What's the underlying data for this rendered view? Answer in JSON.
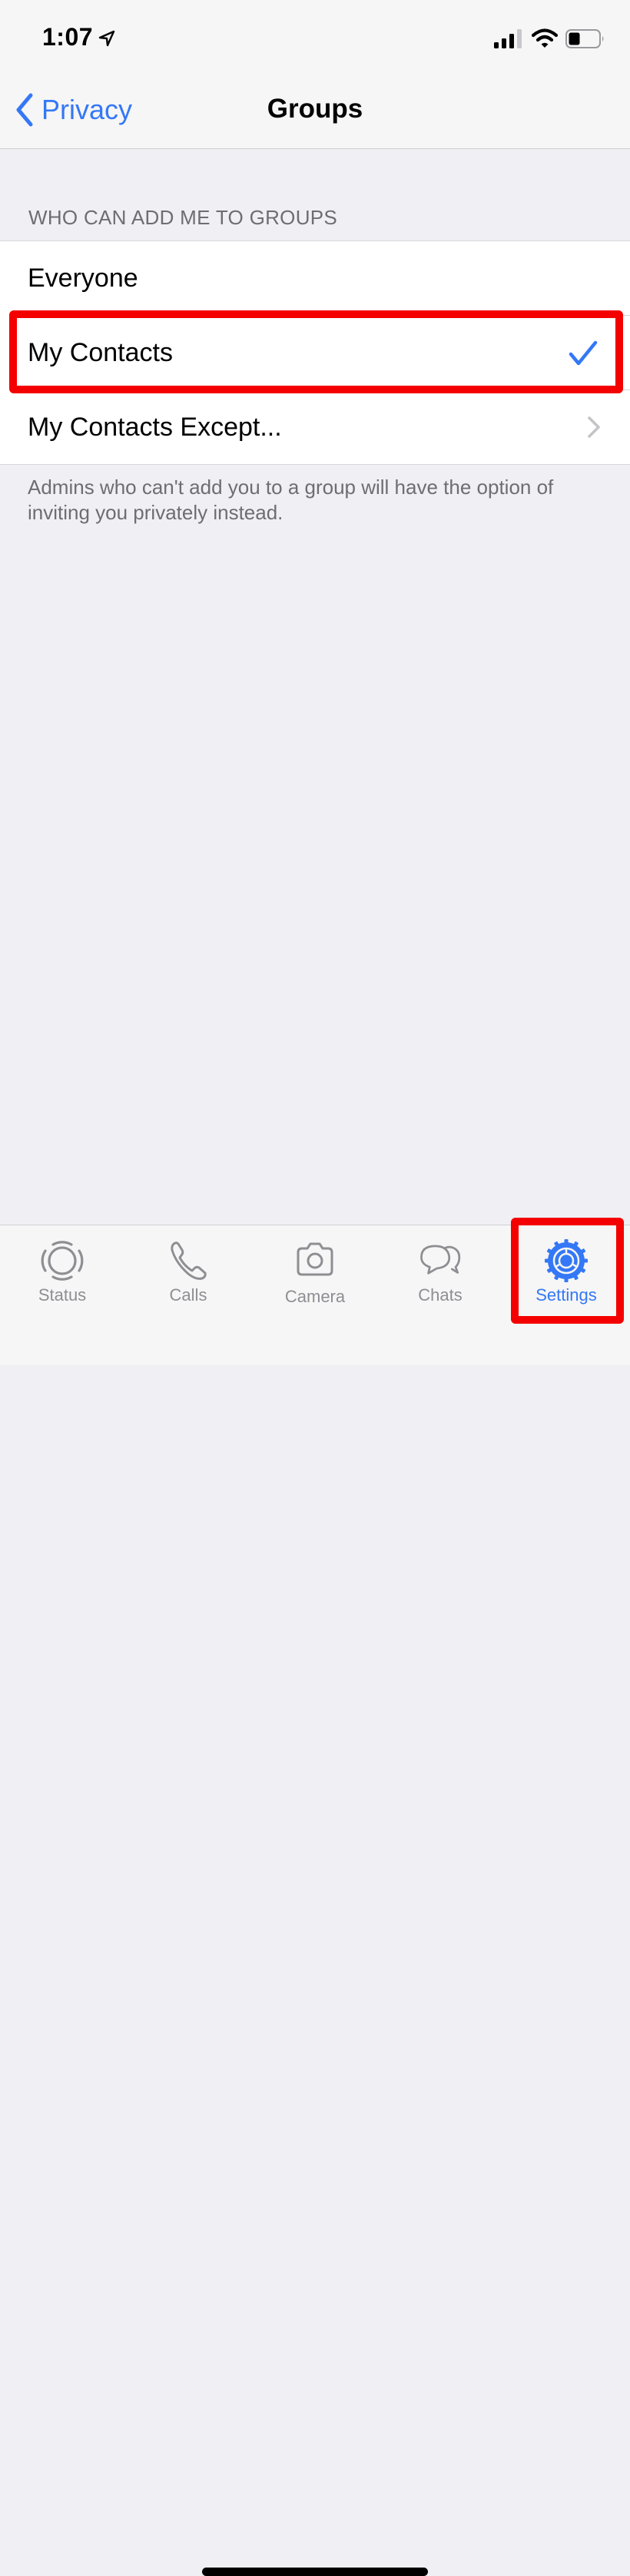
{
  "status_bar": {
    "time": "1:07",
    "location_icon": "location-arrow-icon",
    "signal_bars": 3,
    "signal_bars_total": 4,
    "wifi_icon": "wifi-icon",
    "battery_level_percent": 35
  },
  "nav": {
    "back_label": "Privacy",
    "title": "Groups"
  },
  "section": {
    "header": "WHO CAN ADD ME TO GROUPS",
    "options": [
      {
        "label": "Everyone",
        "selected": false,
        "accessory": "none"
      },
      {
        "label": "My Contacts",
        "selected": true,
        "accessory": "checkmark-icon"
      },
      {
        "label": "My Contacts Except...",
        "selected": false,
        "accessory": "chevron-right-icon"
      }
    ],
    "footer": "Admins who can't add you to a group will have the option of inviting you privately instead."
  },
  "tab_bar": {
    "tabs": [
      {
        "label": "Status",
        "icon": "status-icon",
        "active": false
      },
      {
        "label": "Calls",
        "icon": "phone-icon",
        "active": false
      },
      {
        "label": "Camera",
        "icon": "camera-icon",
        "active": false
      },
      {
        "label": "Chats",
        "icon": "chat-bubbles-icon",
        "active": false
      },
      {
        "label": "Settings",
        "icon": "gear-icon",
        "active": true
      }
    ]
  },
  "annotations": {
    "highlight_color": "#f40000",
    "highlighted": [
      "My Contacts",
      "Settings"
    ]
  },
  "colors": {
    "accent": "#3478f6",
    "inactive": "#8e8e93",
    "background": "#efeff4"
  }
}
